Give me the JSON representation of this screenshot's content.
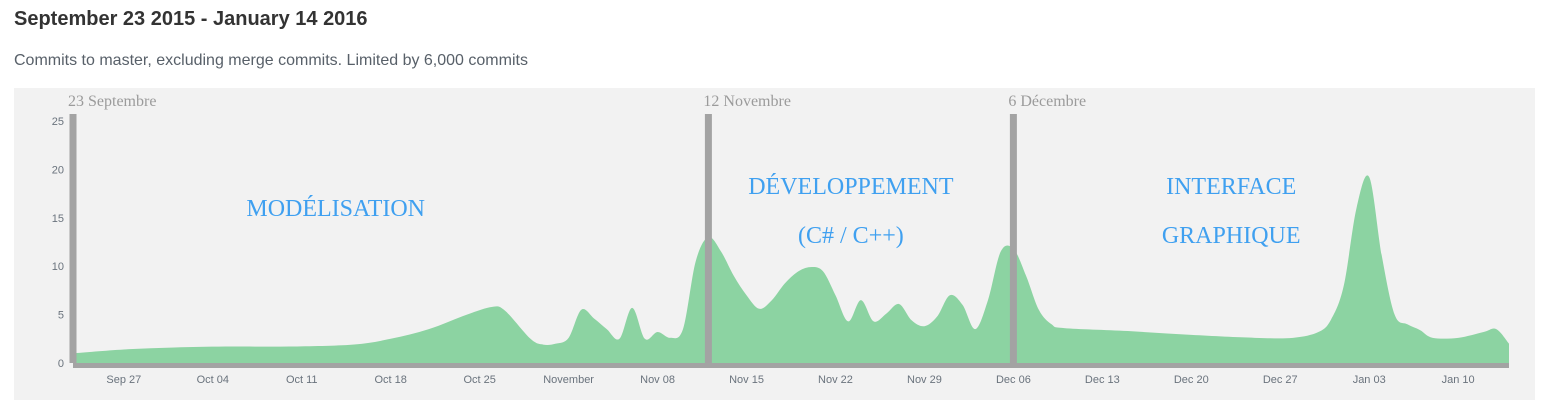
{
  "header": {
    "title": "September 23 2015 - January 14 2016",
    "subtitle": "Commits to master, excluding merge commits. Limited by 6,000 commits"
  },
  "colors": {
    "area_fill": "#8cd3a2",
    "background": "#f2f2f2",
    "marker": "#a3a3a3",
    "phase_text": "#3fa0f0",
    "axis": "#a3a3a3"
  },
  "chart_data": {
    "type": "area",
    "title": "September 23 2015 - January 14 2016",
    "subtitle": "Commits to master, excluding merge commits. Limited by 6,000 commits",
    "xlabel": "",
    "ylabel": "",
    "x_range": [
      "2015-09-23",
      "2016-01-14"
    ],
    "ylim": [
      0,
      25
    ],
    "y_ticks": [
      "0",
      "5",
      "10",
      "15",
      "20",
      "25"
    ],
    "grid": false,
    "x_ticks": [
      {
        "date": "2015-09-27",
        "label": "Sep 27"
      },
      {
        "date": "2015-10-04",
        "label": "Oct 04"
      },
      {
        "date": "2015-10-11",
        "label": "Oct 11"
      },
      {
        "date": "2015-10-18",
        "label": "Oct 18"
      },
      {
        "date": "2015-10-25",
        "label": "Oct 25"
      },
      {
        "date": "2015-11-01",
        "label": "November"
      },
      {
        "date": "2015-11-08",
        "label": "Nov 08"
      },
      {
        "date": "2015-11-15",
        "label": "Nov 15"
      },
      {
        "date": "2015-11-22",
        "label": "Nov 22"
      },
      {
        "date": "2015-11-29",
        "label": "Nov 29"
      },
      {
        "date": "2015-12-06",
        "label": "Dec 06"
      },
      {
        "date": "2015-12-13",
        "label": "Dec 13"
      },
      {
        "date": "2015-12-20",
        "label": "Dec 20"
      },
      {
        "date": "2015-12-27",
        "label": "Dec 27"
      },
      {
        "date": "2016-01-03",
        "label": "Jan 03"
      },
      {
        "date": "2016-01-10",
        "label": "Jan 10"
      }
    ],
    "series": [
      {
        "points": [
          [
            "2015-09-23",
            1.0
          ],
          [
            "2015-09-27",
            1.4
          ],
          [
            "2015-10-01",
            1.6
          ],
          [
            "2015-10-05",
            1.7
          ],
          [
            "2015-10-10",
            1.7
          ],
          [
            "2015-10-15",
            1.9
          ],
          [
            "2015-10-18",
            2.5
          ],
          [
            "2015-10-21",
            3.5
          ],
          [
            "2015-10-24",
            5.0
          ],
          [
            "2015-10-26",
            5.8
          ],
          [
            "2015-10-27",
            5.4
          ],
          [
            "2015-10-29",
            2.5
          ],
          [
            "2015-10-30",
            1.9
          ],
          [
            "2015-10-31",
            2.0
          ],
          [
            "2015-11-01",
            2.6
          ],
          [
            "2015-11-02",
            5.5
          ],
          [
            "2015-11-03",
            4.6
          ],
          [
            "2015-11-04",
            3.5
          ],
          [
            "2015-11-05",
            2.5
          ],
          [
            "2015-11-06",
            5.7
          ],
          [
            "2015-11-07",
            2.5
          ],
          [
            "2015-11-08",
            3.2
          ],
          [
            "2015-11-09",
            2.6
          ],
          [
            "2015-11-10",
            3.5
          ],
          [
            "2015-11-11",
            10.5
          ],
          [
            "2015-11-12",
            13.0
          ],
          [
            "2015-11-13",
            11.5
          ],
          [
            "2015-11-14",
            9.0
          ],
          [
            "2015-11-15",
            7.0
          ],
          [
            "2015-11-16",
            5.6
          ],
          [
            "2015-11-17",
            6.5
          ],
          [
            "2015-11-18",
            8.2
          ],
          [
            "2015-11-19",
            9.4
          ],
          [
            "2015-11-20",
            9.9
          ],
          [
            "2015-11-21",
            9.5
          ],
          [
            "2015-11-22",
            7.0
          ],
          [
            "2015-11-23",
            4.3
          ],
          [
            "2015-11-24",
            6.5
          ],
          [
            "2015-11-25",
            4.3
          ],
          [
            "2015-11-26",
            5.1
          ],
          [
            "2015-11-27",
            6.1
          ],
          [
            "2015-11-28",
            4.4
          ],
          [
            "2015-11-29",
            3.8
          ],
          [
            "2015-11-30",
            4.8
          ],
          [
            "2015-12-01",
            7.0
          ],
          [
            "2015-12-02",
            6.0
          ],
          [
            "2015-12-03",
            3.5
          ],
          [
            "2015-12-04",
            6.5
          ],
          [
            "2015-12-05",
            11.5
          ],
          [
            "2015-12-06",
            11.8
          ],
          [
            "2015-12-07",
            9.0
          ],
          [
            "2015-12-08",
            5.5
          ],
          [
            "2015-12-09",
            4.0
          ],
          [
            "2015-12-10",
            3.6
          ],
          [
            "2015-12-15",
            3.3
          ],
          [
            "2015-12-20",
            2.9
          ],
          [
            "2015-12-25",
            2.6
          ],
          [
            "2015-12-28",
            2.6
          ],
          [
            "2015-12-30",
            3.2
          ],
          [
            "2015-12-31",
            4.5
          ],
          [
            "2016-01-01",
            8.0
          ],
          [
            "2016-01-02",
            16.0
          ],
          [
            "2016-01-03",
            19.2
          ],
          [
            "2016-01-04",
            11.0
          ],
          [
            "2016-01-05",
            5.0
          ],
          [
            "2016-01-06",
            4.0
          ],
          [
            "2016-01-07",
            3.4
          ],
          [
            "2016-01-08",
            2.6
          ],
          [
            "2016-01-10",
            2.6
          ],
          [
            "2016-01-12",
            3.2
          ],
          [
            "2016-01-13",
            3.5
          ],
          [
            "2016-01-14",
            2.0
          ]
        ]
      }
    ],
    "markers": [
      {
        "date": "2015-09-23",
        "label": "23 Septembre"
      },
      {
        "date": "2015-11-12",
        "label": "12 Novembre"
      },
      {
        "date": "2015-12-06",
        "label": "6 Décembre"
      }
    ],
    "phases": [
      {
        "lines": [
          "MODÉLISATION"
        ],
        "start": "2015-09-23",
        "end": "2015-11-12"
      },
      {
        "lines": [
          "DÉVELOPPEMENT",
          "(C# / C++)"
        ],
        "start": "2015-11-12",
        "end": "2015-12-06"
      },
      {
        "lines": [
          "INTERFACE",
          "GRAPHIQUE"
        ],
        "start": "2015-12-06",
        "end": "2016-01-14"
      }
    ]
  }
}
